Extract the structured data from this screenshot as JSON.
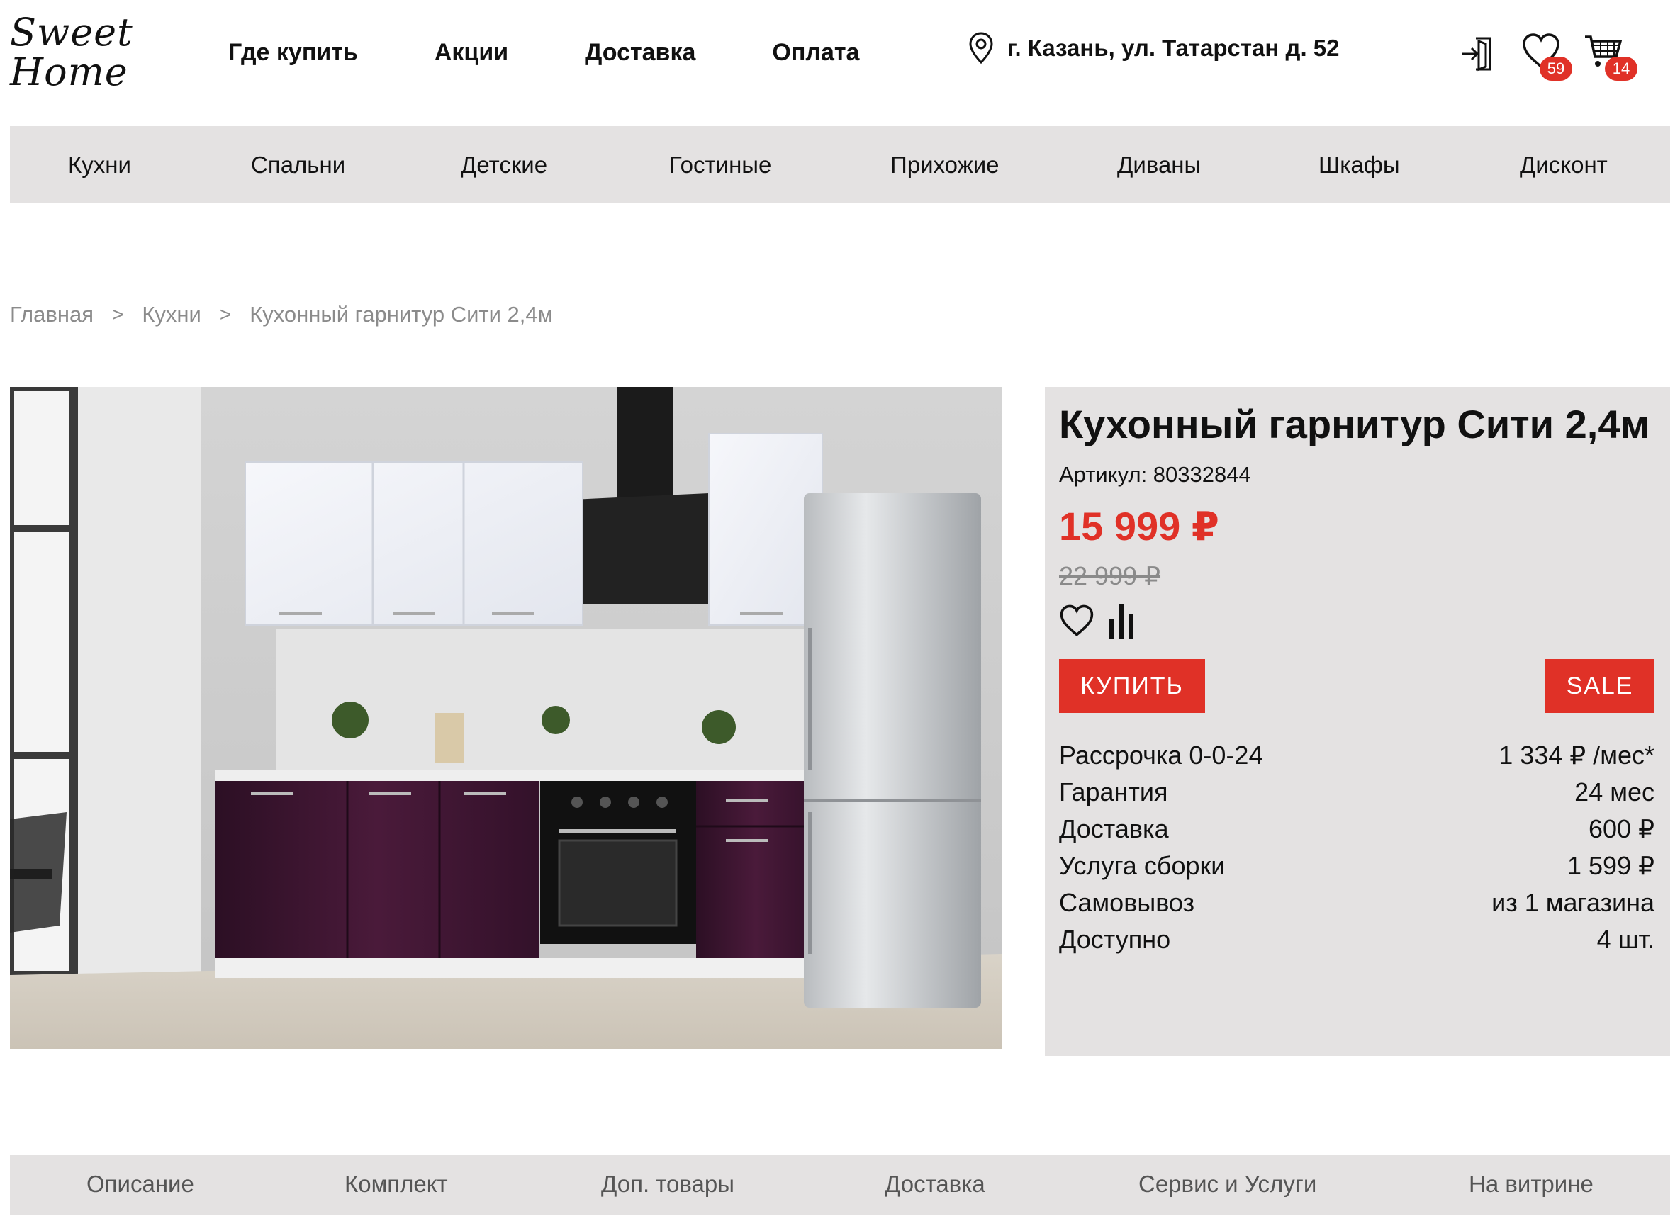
{
  "logo": {
    "line1": "Sweet",
    "line2": "Home"
  },
  "top_nav": [
    {
      "label": "Где купить"
    },
    {
      "label": "Акции"
    },
    {
      "label": "Доставка"
    },
    {
      "label": "Оплата"
    }
  ],
  "address": {
    "icon": "location-pin-icon",
    "text": "г. Казань, ул. Татарстан д. 52"
  },
  "header_icons": {
    "login": "login-icon",
    "favorites": {
      "icon": "heart-icon",
      "count": "59"
    },
    "cart": {
      "icon": "cart-icon",
      "count": "14"
    }
  },
  "categories": [
    {
      "label": "Кухни"
    },
    {
      "label": "Спальни"
    },
    {
      "label": "Детские"
    },
    {
      "label": "Гостиные"
    },
    {
      "label": "Прихожие"
    },
    {
      "label": "Диваны"
    },
    {
      "label": "Шкафы"
    },
    {
      "label": "Дисконт"
    }
  ],
  "breadcrumb": {
    "items": [
      "Главная",
      "Кухни",
      "Кухонный гарнитур Сити 2,4м"
    ],
    "separator": ">"
  },
  "product": {
    "title": "Кухонный гарнитур Сити 2,4м",
    "sku": "Артикул: 80332844",
    "price": "15 999 ₽",
    "old_price": "22 999 ₽",
    "buy_label": "КУПИТЬ",
    "sale_label": "SALE",
    "specs": [
      {
        "label": "Рассрочка 0-0-24",
        "value": "1 334 ₽ /мес*"
      },
      {
        "label": "Гарантия",
        "value": "24 мес"
      },
      {
        "label": "Доставка",
        "value": "600 ₽"
      },
      {
        "label": "Услуга сборки",
        "value": "1 599 ₽"
      },
      {
        "label": "Самовывоз",
        "value": "из 1 магазина"
      },
      {
        "label": "Доступно",
        "value": "4 шт."
      }
    ]
  },
  "tabs": [
    {
      "label": "Описание"
    },
    {
      "label": "Комплект"
    },
    {
      "label": "Доп. товары"
    },
    {
      "label": "Доставка"
    },
    {
      "label": "Сервис и Услуги"
    },
    {
      "label": "На витрине"
    }
  ],
  "colors": {
    "accent": "#e03127",
    "bar": "#e4e2e2",
    "cabinet_lower": "#3d1530"
  }
}
